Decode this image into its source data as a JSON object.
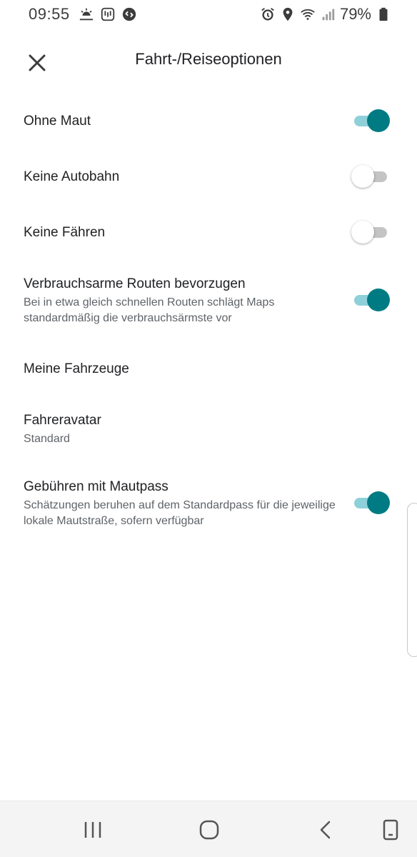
{
  "status_bar": {
    "time": "09:55",
    "battery_percent": "79%",
    "icons_left": [
      "weather-sunset-icon",
      "notification-app-icon",
      "shazam-icon"
    ],
    "icons_right": [
      "alarm-icon",
      "location-icon",
      "wifi-icon",
      "signal-icon",
      "battery-icon"
    ]
  },
  "app_bar": {
    "title": "Fahrt-/Reiseoptionen",
    "close_icon": "close-icon"
  },
  "options": [
    {
      "title": "Ohne Maut",
      "subtitle": "",
      "toggle": true
    },
    {
      "title": "Keine Autobahn",
      "subtitle": "",
      "toggle": false
    },
    {
      "title": "Keine Fähren",
      "subtitle": "",
      "toggle": false
    },
    {
      "title": "Verbrauchsarme Routen bevorzugen",
      "subtitle": "Bei in etwa gleich schnellen Routen schlägt Maps standardmäßig die verbrauchsärmste vor",
      "toggle": true
    },
    {
      "title": "Meine Fahrzeuge",
      "subtitle": ""
    },
    {
      "title": "Fahreravatar",
      "subtitle": "Standard"
    },
    {
      "title": "Gebühren mit Mautpass",
      "subtitle": "Schätzungen beruhen auf dem Standardpass für die jeweilige lokale Mautstraße, sofern verfügbar",
      "toggle": true
    }
  ],
  "colors": {
    "accent": "#007b83",
    "accent_track": "#8ed0da",
    "off_track": "#c4c4c4"
  },
  "nav_bar": {
    "buttons": [
      "recent-apps-icon",
      "home-icon",
      "back-icon",
      "screenshot-icon"
    ]
  }
}
